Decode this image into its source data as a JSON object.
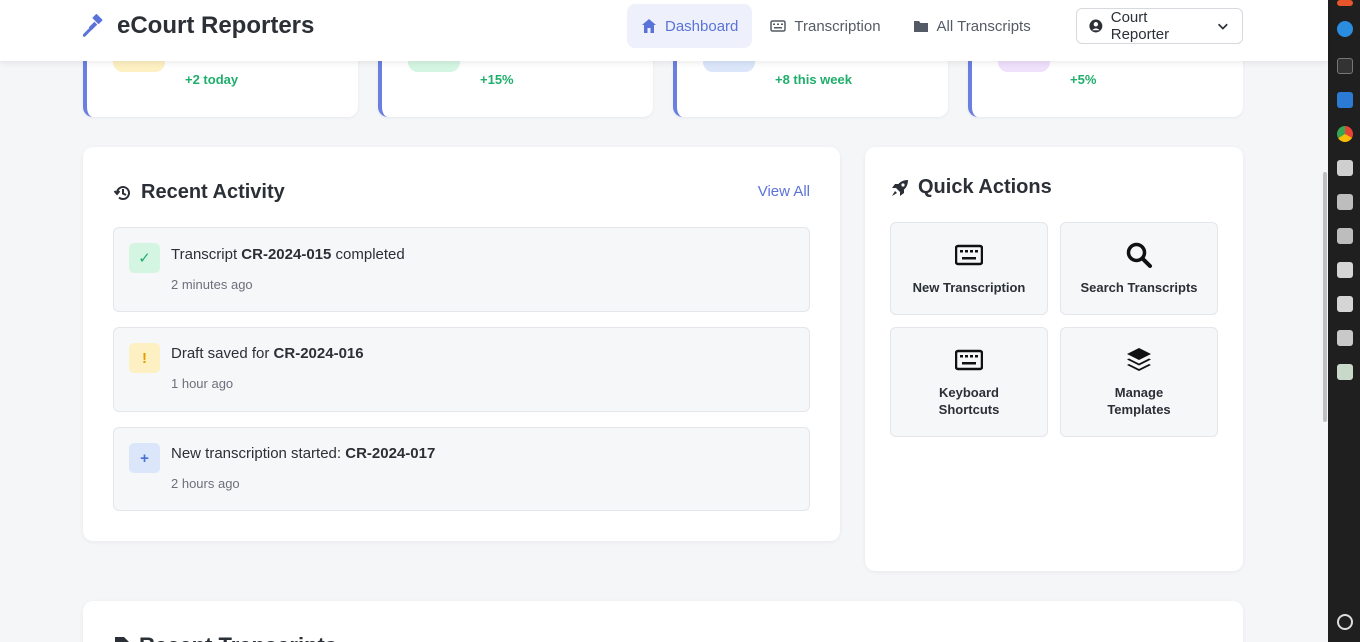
{
  "app": {
    "title": "eCourt Reporters"
  },
  "nav": {
    "items": [
      {
        "label": "Dashboard",
        "icon": "home-icon",
        "active": true
      },
      {
        "label": "Transcription",
        "icon": "keyboard-icon",
        "active": false
      },
      {
        "label": "All Transcripts",
        "icon": "folder-icon",
        "active": false
      }
    ],
    "user_label": "Court Reporter"
  },
  "stats": [
    {
      "change": "+2 today",
      "icon_color": "#fdf0c2"
    },
    {
      "change": "+15%",
      "icon_color": "#d5f5e3"
    },
    {
      "change": "+8 this week",
      "icon_color": "#dbe6fb"
    },
    {
      "change": "+5%",
      "icon_color": "#efe0fb"
    }
  ],
  "recent_activity": {
    "title": "Recent Activity",
    "view_all": "View All",
    "items": [
      {
        "prefix": "Transcript ",
        "id": "CR-2024-015",
        "suffix": " completed",
        "time": "2 minutes ago",
        "badge": "✓",
        "badge_bg": "#d5f5e3",
        "badge_color": "#1fae6b"
      },
      {
        "prefix": "Draft saved for ",
        "id": "CR-2024-016",
        "suffix": "",
        "time": "1 hour ago",
        "badge": "!",
        "badge_bg": "#fdf0c2",
        "badge_color": "#e0a100"
      },
      {
        "prefix": "New transcription started: ",
        "id": "CR-2024-017",
        "suffix": "",
        "time": "2 hours ago",
        "badge": "+",
        "badge_bg": "#dbe6fb",
        "badge_color": "#4a6fd6"
      }
    ]
  },
  "quick_actions": {
    "title": "Quick Actions",
    "items": [
      {
        "label": "New Transcription",
        "icon": "keyboard-icon"
      },
      {
        "label": "Search Transcripts",
        "icon": "search-icon"
      },
      {
        "label": "Keyboard Shortcuts",
        "icon": "keyboard-icon"
      },
      {
        "label": "Manage Templates",
        "icon": "layers-icon"
      }
    ]
  },
  "bottom_section": {
    "title": "Recent Transcripts"
  },
  "colors": {
    "accent": "#5b73d9",
    "success": "#1fae6b"
  }
}
